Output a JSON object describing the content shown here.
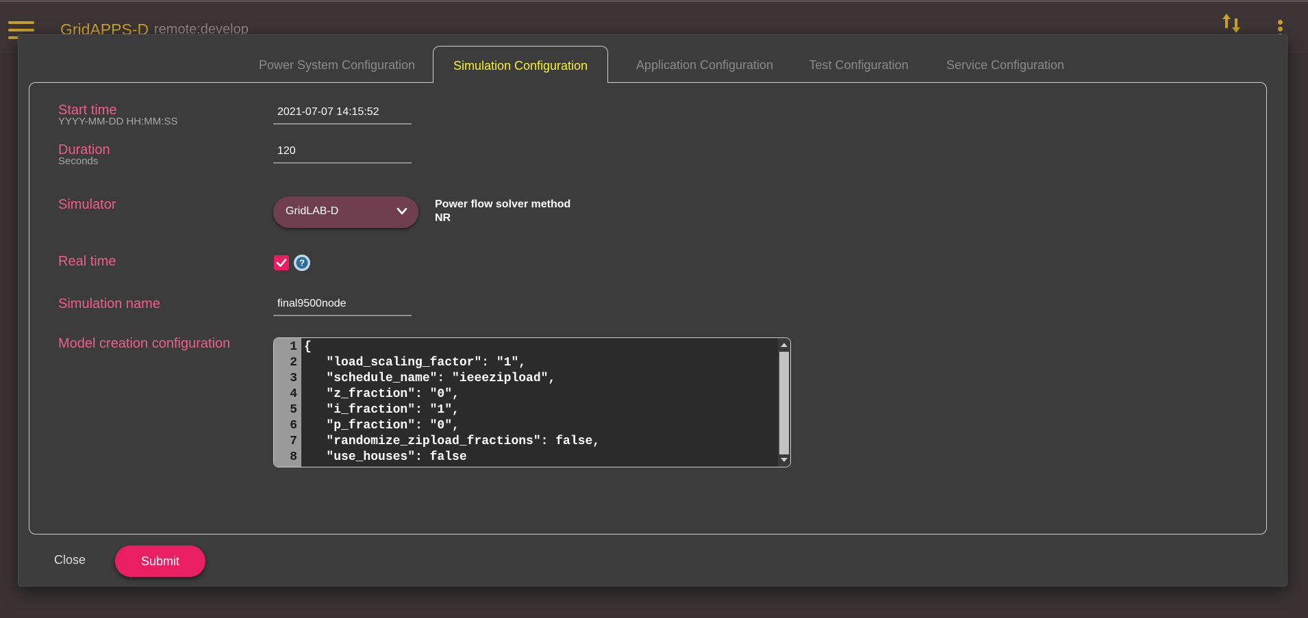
{
  "header": {
    "title": "GridAPPS-D",
    "subtitle": "remote:develop",
    "menu_icon": "hamburger-menu-icon",
    "sort_icon": "sort-arrows-icon",
    "more_icon": "more-vertical-icon",
    "accent_color": "#c9a227"
  },
  "tabs": [
    {
      "label": "Power System Configuration",
      "active": false
    },
    {
      "label": "Simulation Configuration",
      "active": true
    },
    {
      "label": "Application Configuration",
      "active": false
    },
    {
      "label": "Test Configuration",
      "active": false
    },
    {
      "label": "Service Configuration",
      "active": false
    }
  ],
  "form": {
    "start_time": {
      "label": "Start time",
      "hint": "YYYY-MM-DD HH:MM:SS",
      "value": "2021-07-07 14:15:52"
    },
    "duration": {
      "label": "Duration",
      "hint": "Seconds",
      "value": "120"
    },
    "simulator": {
      "label": "Simulator",
      "selected": "GridLAB-D",
      "solver_label": "Power flow solver method",
      "solver_value": "NR"
    },
    "real_time": {
      "label": "Real time",
      "checked": true,
      "help_icon": "question-circle-icon"
    },
    "simulation_name": {
      "label": "Simulation name",
      "value": "final9500node"
    },
    "model_config": {
      "label": "Model creation configuration",
      "lines": [
        {
          "no": "1",
          "text": "{"
        },
        {
          "no": "2",
          "text": "   \"load_scaling_factor\": \"1\","
        },
        {
          "no": "3",
          "text": "   \"schedule_name\": \"ieeezipload\","
        },
        {
          "no": "4",
          "text": "   \"z_fraction\": \"0\","
        },
        {
          "no": "5",
          "text": "   \"i_fraction\": \"1\","
        },
        {
          "no": "6",
          "text": "   \"p_fraction\": \"0\","
        },
        {
          "no": "7",
          "text": "   \"randomize_zipload_fractions\": false,"
        },
        {
          "no": "8",
          "text": "   \"use_houses\": false"
        }
      ]
    }
  },
  "actions": {
    "close_label": "Close",
    "submit_label": "Submit"
  },
  "colors": {
    "label_pink": "#ef5f88",
    "active_tab": "#f5ef2f",
    "primary_button": "#e91e63",
    "select_bg": "#6f3f4f"
  }
}
